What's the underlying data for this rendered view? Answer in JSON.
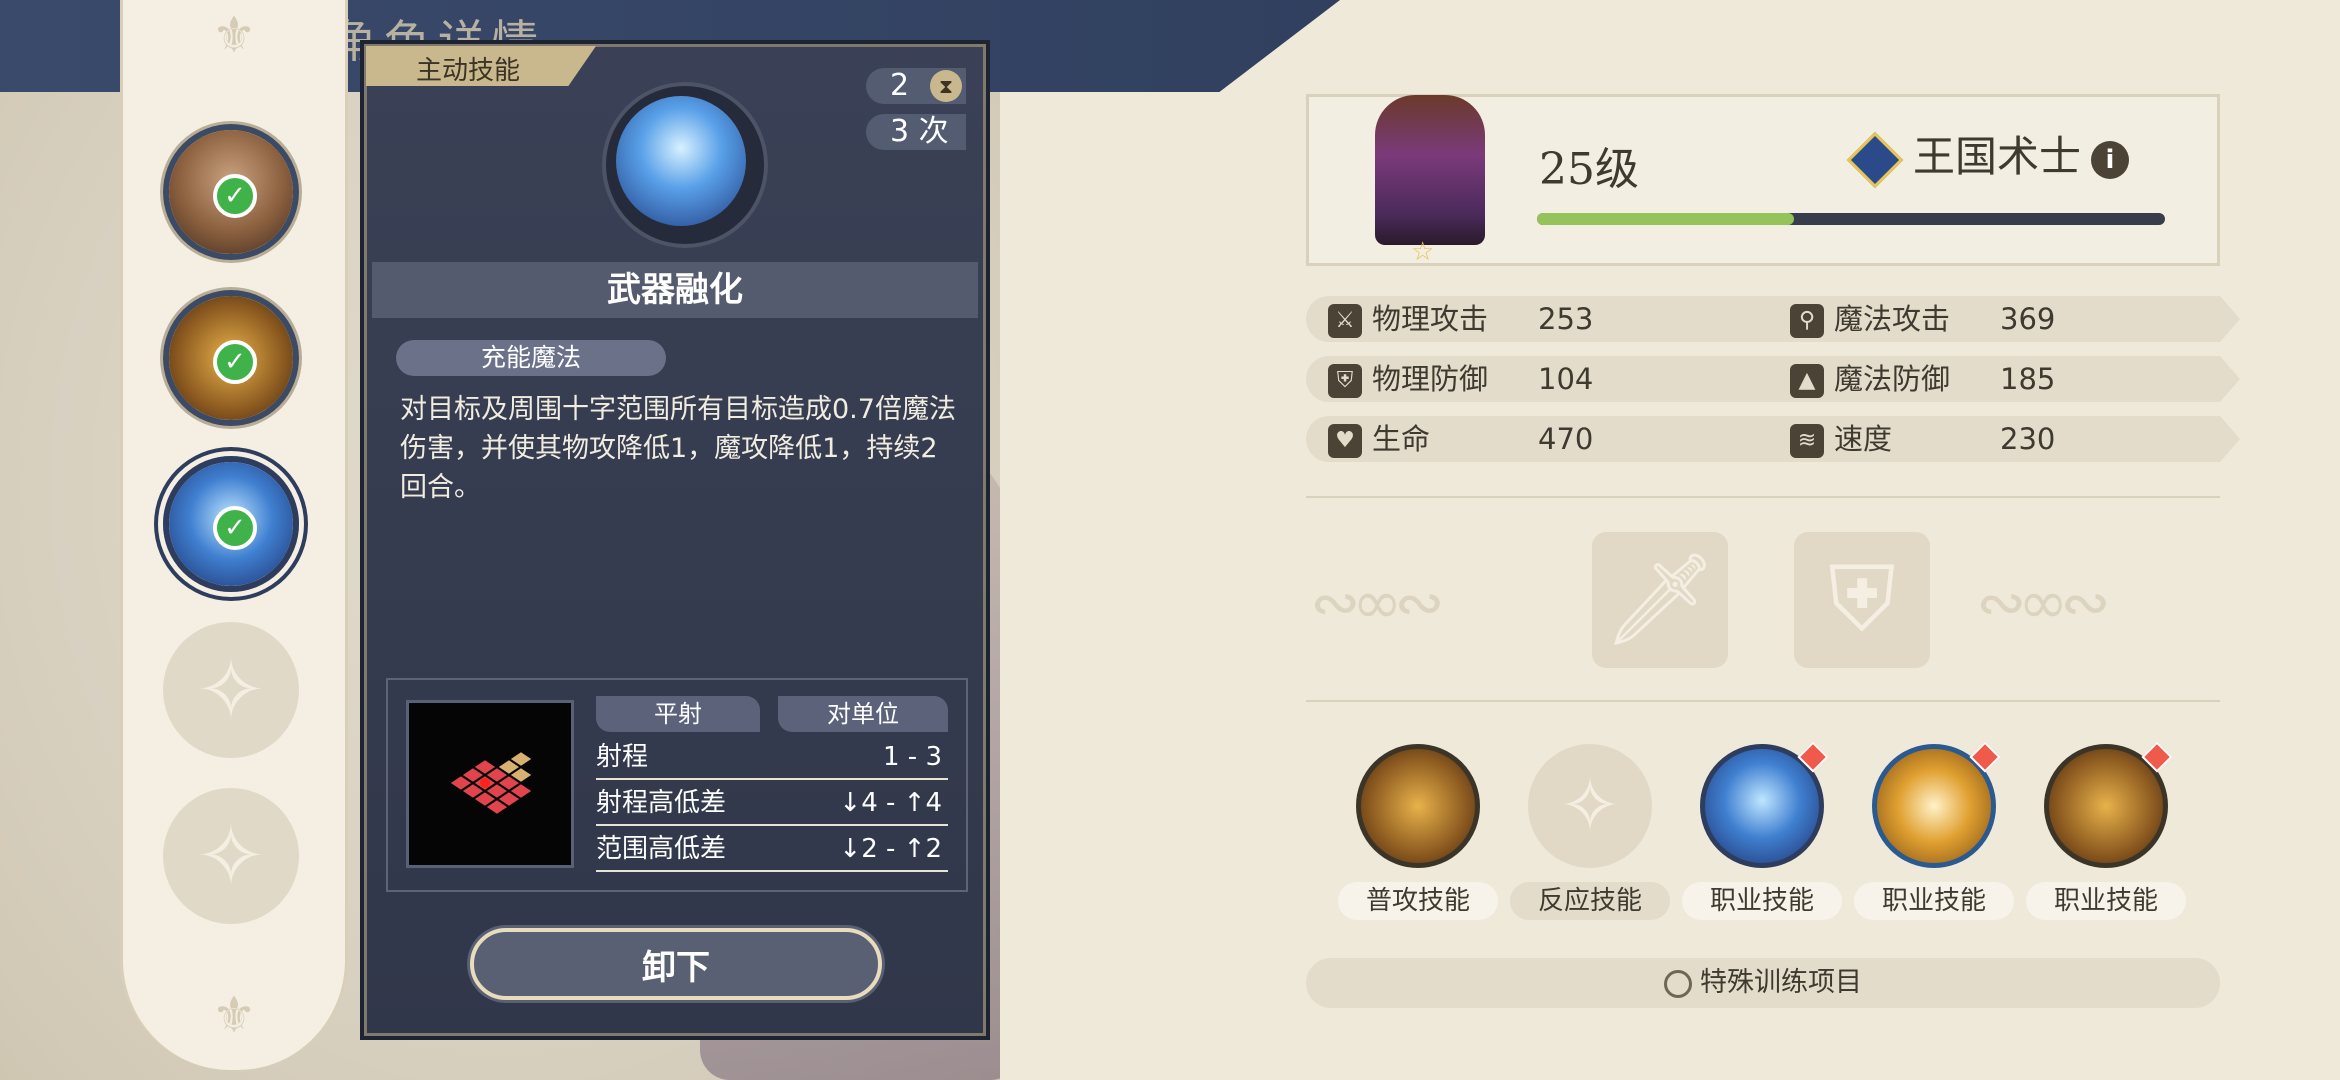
{
  "header": {
    "title": "角色详情"
  },
  "slots": [
    {
      "state": "equipped",
      "art": "brown-swirl-icon"
    },
    {
      "state": "equipped",
      "art": "golden-arrow-icon"
    },
    {
      "state": "equipped-selected",
      "art": "blue-crystal-icon"
    },
    {
      "state": "empty",
      "art": "wand-icon"
    },
    {
      "state": "empty",
      "art": "wand-icon"
    }
  ],
  "popup": {
    "tag": "主动技能",
    "count": "2",
    "uses": "3 次",
    "skill_name": "武器融化",
    "type_chip": "充能魔法",
    "description": "对目标及周围十字范围所有目标造成0.7倍魔法伤害，并使其物攻降低1，魔攻降低1，持续2回合。",
    "range_headers": [
      "平射",
      "对单位"
    ],
    "range_rows": [
      {
        "label": "射程",
        "value": "1 - 3"
      },
      {
        "label": "射程高低差",
        "value": "↓4 - ↑4"
      },
      {
        "label": "范围高低差",
        "value": "↓2 - ↑2"
      }
    ],
    "unload_label": "卸下"
  },
  "character": {
    "level": "25级",
    "job": "王国术士",
    "xp_fraction": 0.41
  },
  "stats": [
    {
      "left_label": "物理攻击",
      "left_value": "253",
      "right_label": "魔法攻击",
      "right_value": "369"
    },
    {
      "left_label": "物理防御",
      "left_value": "104",
      "right_label": "魔法防御",
      "right_value": "185"
    },
    {
      "left_label": "生命",
      "left_value": "470",
      "right_label": "速度",
      "right_value": "230"
    }
  ],
  "skills": [
    {
      "label": "普攻技能",
      "art": "golden-arrow-icon"
    },
    {
      "label": "反应技能",
      "art": "wand-icon"
    },
    {
      "label": "职业技能",
      "art": "blue-crystal-icon"
    },
    {
      "label": "职业技能",
      "art": "golden-swirl-icon"
    },
    {
      "label": "职业技能",
      "art": "golden-arrow-icon"
    }
  ],
  "training": {
    "label": "特殊训练项目"
  },
  "colors": {
    "panel_dark": "#353b4e",
    "accent_gold": "#c9b88e",
    "xp_green": "#94c35b",
    "check_green": "#3fb24a"
  }
}
